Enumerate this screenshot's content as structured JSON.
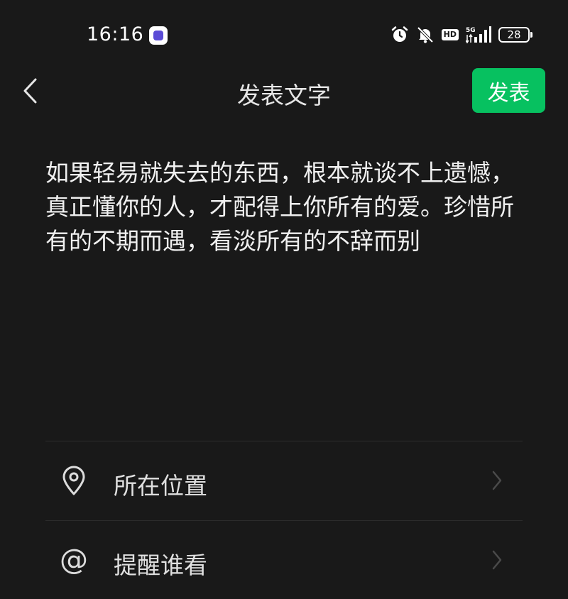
{
  "status_bar": {
    "time": "16:16",
    "hd": "HD",
    "network": "5G",
    "battery": "28"
  },
  "nav": {
    "title": "发表文字",
    "publish_label": "发表"
  },
  "post": {
    "text": "如果轻易就失去的东西，根本就谈不上遗憾，真正懂你的人，才配得上你所有的爱。珍惜所有的不期而遇，看淡所有的不辞而别"
  },
  "options": {
    "location_label": "所在位置",
    "mention_label": "提醒谁看"
  },
  "icons": {
    "back": "chevron-left-icon",
    "alarm": "alarm-icon",
    "mute": "bell-off-icon",
    "signal": "signal-icon",
    "location": "location-pin-icon",
    "mention": "at-icon",
    "chevron": "chevron-right-icon"
  },
  "colors": {
    "background": "#191919",
    "accent": "#07c160"
  }
}
